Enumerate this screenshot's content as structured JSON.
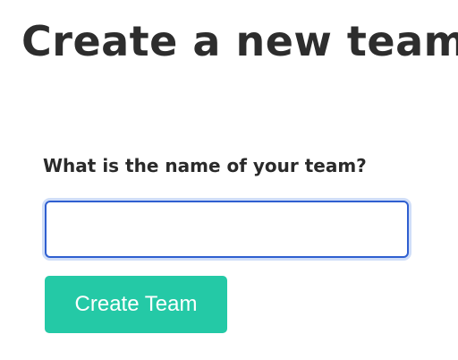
{
  "page": {
    "title": "Create a new team"
  },
  "form": {
    "team_name_label": "What is the name of your team?",
    "team_name_value": "",
    "team_name_placeholder": "",
    "submit_label": "Create Team"
  },
  "colors": {
    "primary_button": "#24c9a6",
    "input_focus_border": "#2f5fd0",
    "text": "#2d2d2d"
  }
}
